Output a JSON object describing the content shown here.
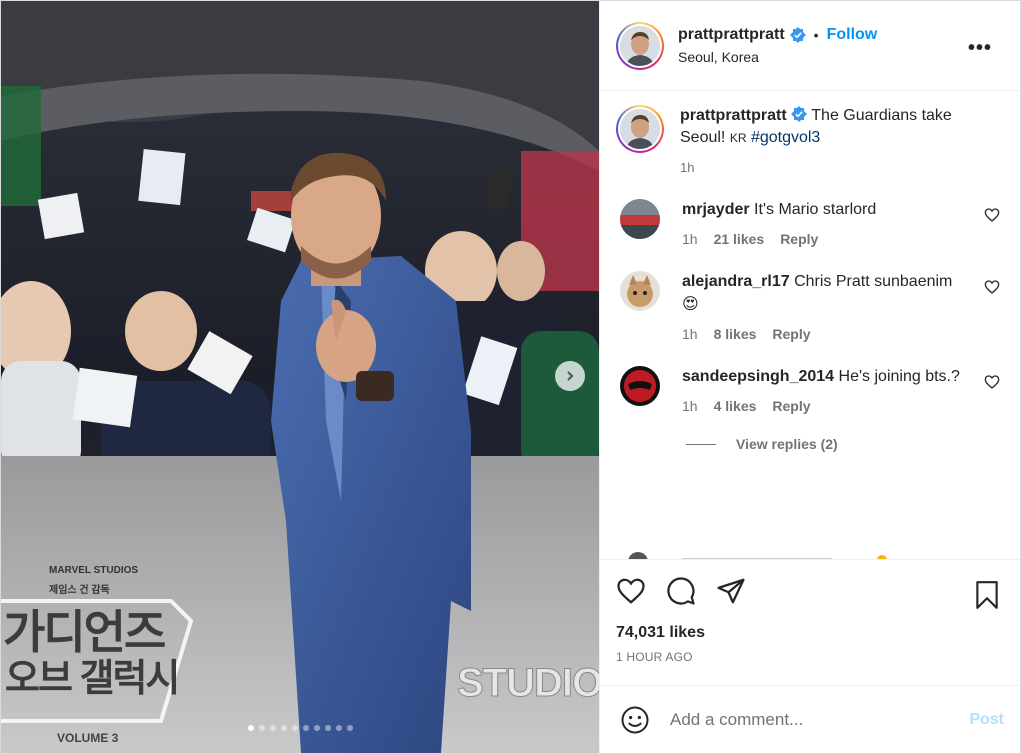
{
  "post": {
    "username": "prattprattpratt",
    "follow_label": "Follow",
    "separator": "•",
    "location": "Seoul, Korea",
    "more_label": "•••",
    "banner_brand": "MARVEL STUDIOS",
    "banner_korean_small": "제임스 건 감독",
    "banner_title_line1": "가디언즈",
    "banner_title_line2": "오브 갤럭시",
    "banner_volume": "VOLUME 3",
    "banner_studios": "STUDIOS"
  },
  "caption": {
    "username": "prattprattpratt",
    "text_1": "The Guardians take Seoul! ",
    "flag": "KR",
    "hashtag": "#gotgvol3",
    "time": "1h"
  },
  "comments": [
    {
      "username": "mrjayder",
      "text": "It's Mario starlord",
      "time": "1h",
      "likes": "21 likes",
      "reply": "Reply"
    },
    {
      "username": "alejandra_rl17",
      "text": "Chris Pratt sunbaenim",
      "emoji": "😍",
      "time": "1h",
      "likes": "8 likes",
      "reply": "Reply"
    },
    {
      "username": "sandeepsingh_2014",
      "text": "He's joining bts.?",
      "time": "1h",
      "likes": "4 likes",
      "reply": "Reply"
    }
  ],
  "view_replies": "View replies (2)",
  "likes_count": "74,031 likes",
  "posted_ago": "1 HOUR AGO",
  "add_comment": {
    "placeholder": "Add a comment...",
    "post_label": "Post"
  },
  "carousel": {
    "total": 10,
    "active": 1
  },
  "colors": {
    "accent": "#0095f6",
    "verified": "#3897f0",
    "post_disabled": "#b2dffc",
    "suit": "#3a5a9a"
  }
}
